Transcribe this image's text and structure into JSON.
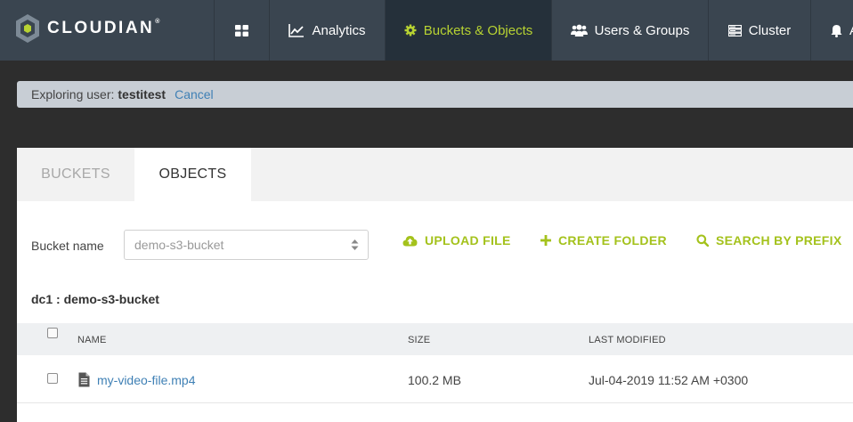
{
  "app": {
    "logo_text": "CLOUDIAN",
    "logo_mark": "®"
  },
  "nav": {
    "dashboard_icon": "grid-icon",
    "items": [
      {
        "label": "Analytics",
        "icon": "line-chart-icon"
      },
      {
        "label": "Buckets & Objects",
        "icon": "gear-icon",
        "active": true
      },
      {
        "label": "Users & Groups",
        "icon": "users-icon"
      },
      {
        "label": "Cluster",
        "icon": "server-icon"
      },
      {
        "label": "A",
        "icon": "bell-icon"
      }
    ]
  },
  "explore": {
    "prefix": "Exploring user:",
    "user": "testitest",
    "cancel": "Cancel"
  },
  "tabs": [
    {
      "label": "BUCKETS",
      "active": false
    },
    {
      "label": "OBJECTS",
      "active": true
    }
  ],
  "bucket": {
    "label": "Bucket name",
    "selected": "demo-s3-bucket"
  },
  "actions": {
    "upload": "UPLOAD FILE",
    "create_folder": "CREATE FOLDER",
    "search_prefix": "SEARCH BY PREFIX"
  },
  "path": "dc1 : demo-s3-bucket",
  "table": {
    "columns": [
      "NAME",
      "SIZE",
      "LAST MODIFIED"
    ],
    "rows": [
      {
        "name": "my-video-file.mp4",
        "size": "100.2 MB",
        "modified": "Jul-04-2019 11:52 AM +0300"
      }
    ]
  },
  "colors": {
    "accent": "#a4c21c",
    "nav_bg": "#3a4550",
    "link": "#3f80b5"
  }
}
